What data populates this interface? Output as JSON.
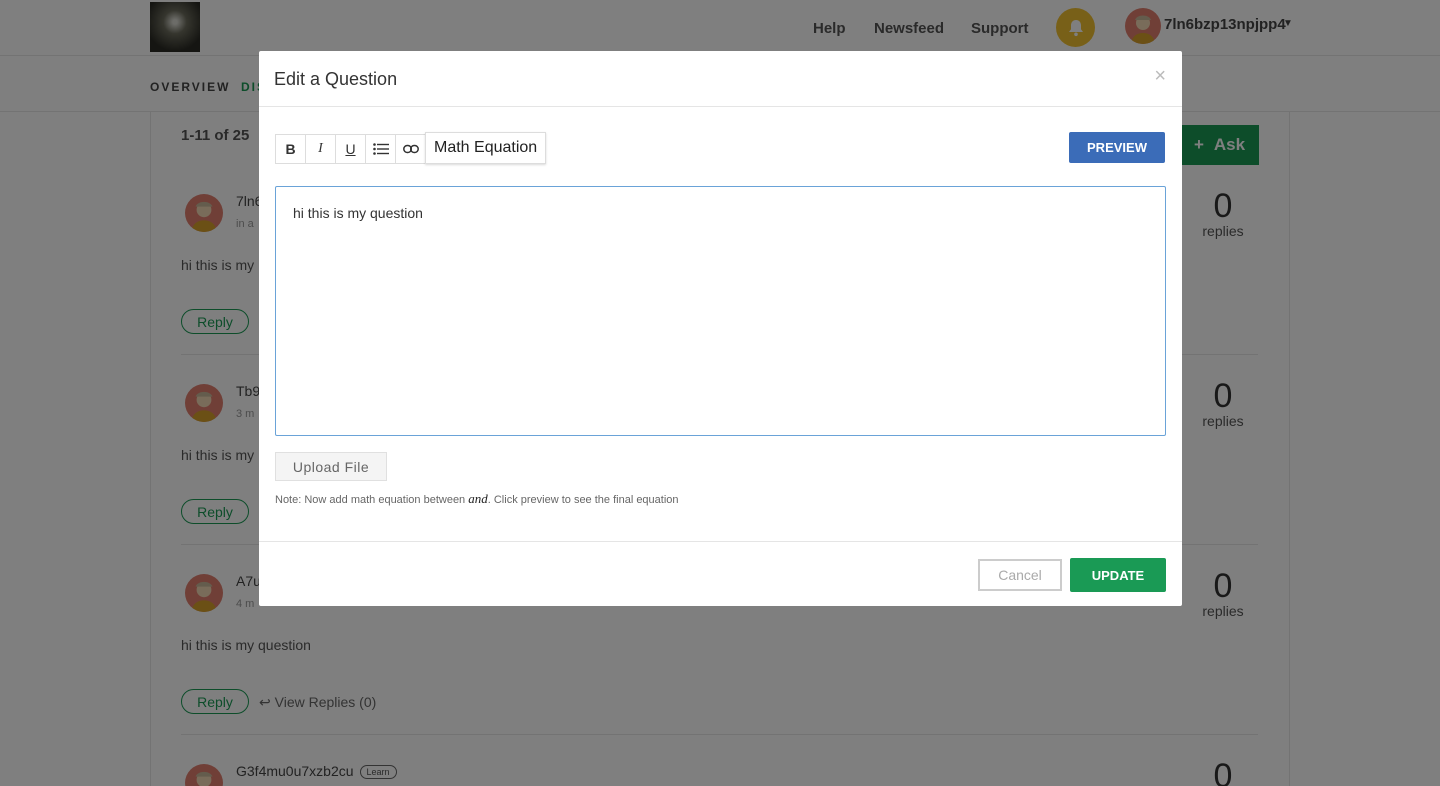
{
  "header": {
    "nav": [
      "Help",
      "Newsfeed",
      "Support"
    ],
    "username": "7ln6bzp13npjpp4",
    "icons": {
      "bell": "bell-icon",
      "caret": "caret-down-icon"
    }
  },
  "subnav": {
    "tabs": [
      "OVERVIEW",
      "DIS"
    ]
  },
  "main": {
    "count_label": "1-11 of 25",
    "ask_label": "Ask",
    "posts": [
      {
        "author": "7ln6",
        "meta": "in a",
        "body": "hi this is my",
        "reply": "Reply",
        "count": "0",
        "count_label": "replies"
      },
      {
        "author": "Tb9",
        "meta": "3 m",
        "body": "hi this is my",
        "reply": "Reply",
        "count": "0",
        "count_label": "replies"
      },
      {
        "author": "A7u",
        "meta": "4 m",
        "body": "hi this is my question",
        "reply": "Reply",
        "view_replies": "View Replies (0)",
        "count": "0",
        "count_label": "replies"
      },
      {
        "author": "G3f4mu0u7xzb2cu",
        "badge": "Learn",
        "count": "0"
      }
    ]
  },
  "modal": {
    "title": "Edit a Question",
    "close": "×",
    "toolbar": {
      "bold": "B",
      "italic": "I",
      "underline": "U",
      "math": "Math Equation"
    },
    "preview_label": "PREVIEW",
    "editor_text": "hi this is my question",
    "upload_label": "Upload File",
    "note_prefix": "Note: Now add math equation between ",
    "note_math": "and",
    "note_suffix": ". Click preview to see the final equation",
    "cancel_label": "Cancel",
    "update_label": "UPDATE"
  },
  "colors": {
    "accent_green": "#1a9a55",
    "preview_blue": "#3b6cb8",
    "bell_yellow": "#f0c030"
  }
}
